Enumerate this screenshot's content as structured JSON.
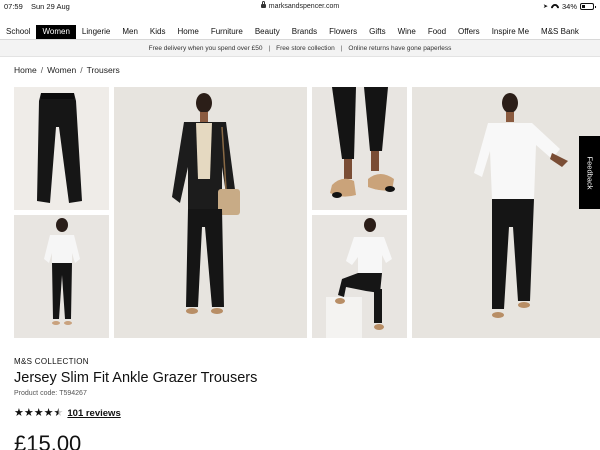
{
  "status_bar": {
    "time": "07:59",
    "date": "Sun 29 Aug",
    "url": "marksandspencer.com",
    "battery": "34%",
    "battery_level": 0.34
  },
  "nav": {
    "items": [
      "School",
      "Women",
      "Lingerie",
      "Men",
      "Kids",
      "Home",
      "Furniture",
      "Beauty",
      "Brands",
      "Flowers",
      "Gifts",
      "Wine",
      "Food",
      "Offers",
      "Inspire Me",
      "M&S Bank"
    ],
    "active": "Women"
  },
  "promo": {
    "messages": [
      "Free delivery when you spend over £50",
      "Free store collection",
      "Online returns have gone paperless"
    ],
    "separator": "|"
  },
  "breadcrumb": {
    "items": [
      "Home",
      "Women",
      "Trousers"
    ],
    "separator": "/"
  },
  "gallery": {
    "images": [
      "trousers-flat-lay-icon",
      "model-back-view-icon",
      "model-blazer-front-icon",
      "ankle-shoes-closeup-icon",
      "model-seated-icon",
      "model-white-top-icon"
    ]
  },
  "feedback": {
    "label": "Feedback"
  },
  "product": {
    "brand": "M&S COLLECTION",
    "title": "Jersey Slim Fit Ankle Grazer Trousers",
    "code_label": "Product code:",
    "code": "T594267",
    "rating": 4.5,
    "reviews_label": "101 reviews",
    "price": "£15.00"
  },
  "colors": {
    "active_nav_bg": "#000000",
    "promo_bg": "#f3f3f3",
    "photo_bg": "#e9e6e2"
  }
}
